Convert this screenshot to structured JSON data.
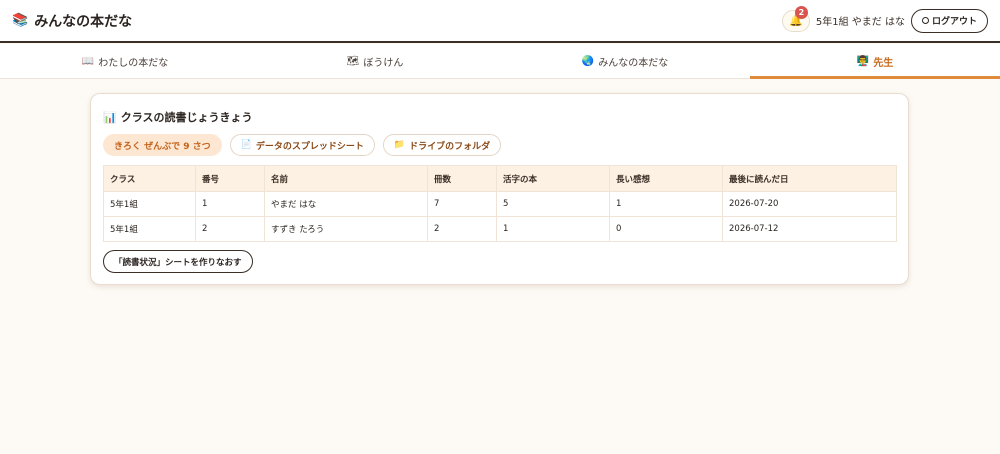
{
  "header": {
    "logo_icon": "📚",
    "title": "みんなの本だな",
    "notification_count": "2",
    "bell_icon": "🔔",
    "user_name": "5年1組 やまだ はな",
    "logout_label": "ログアウト"
  },
  "tabs": [
    {
      "icon": "📖",
      "label": "わたしの本だな",
      "active": false
    },
    {
      "icon": "🗺",
      "label": "ぼうけん",
      "active": false
    },
    {
      "icon": "🌏",
      "label": "みんなの本だな",
      "active": false
    },
    {
      "icon": "👨‍🏫",
      "label": "先生",
      "active": true
    }
  ],
  "card": {
    "title_icon": "📊",
    "title": "クラスの読書じょうきょう",
    "summary_pill": "きろく ぜんぶで 9 さつ",
    "sheet_button": {
      "icon": "📄",
      "label": "データのスプレッドシート"
    },
    "drive_button": {
      "icon": "📁",
      "label": "ドライブのフォルダ"
    },
    "table": {
      "headers": [
        "クラス",
        "番号",
        "名前",
        "冊数",
        "活字の本",
        "長い感想",
        "最後に読んだ日"
      ],
      "rows": [
        [
          "5年1組",
          "1",
          "やまだ はな",
          "7",
          "5",
          "1",
          "2026-07-20"
        ],
        [
          "5年1組",
          "2",
          "すずき たろう",
          "2",
          "1",
          "0",
          "2026-07-12"
        ]
      ]
    },
    "rebuild_button": "「読書状況」シートを作りなおす"
  }
}
